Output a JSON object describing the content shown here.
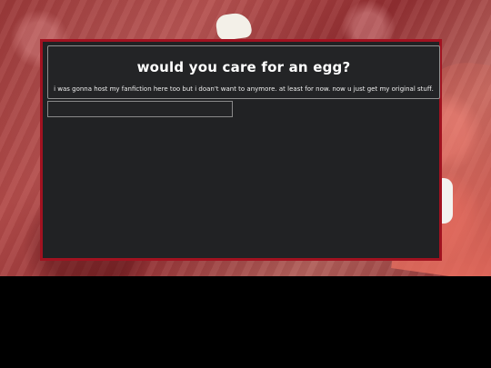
{
  "page": {
    "title": "would you care for an egg?",
    "description": "i was gonna host my fanfiction here too but i doan't want to anymore. at least for now. now u just get my original stuff."
  },
  "colors": {
    "panel_background": "#212224",
    "panel_border": "#a11220",
    "text": "#ffffff",
    "outer_background": "#000000"
  }
}
